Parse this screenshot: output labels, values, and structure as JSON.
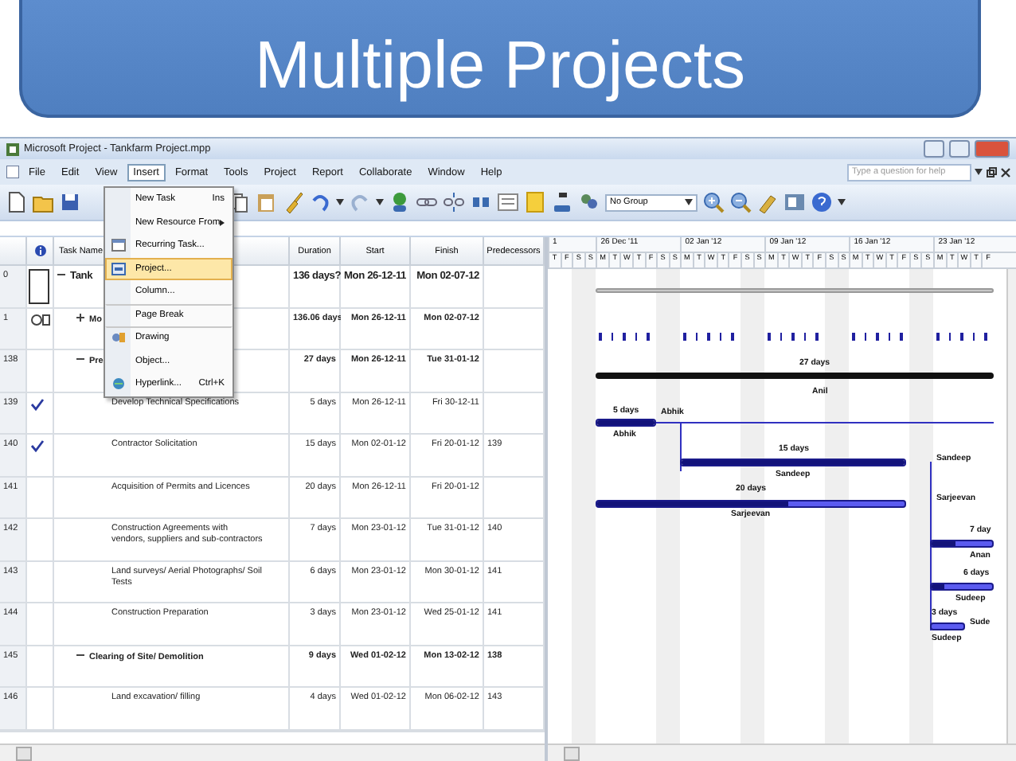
{
  "slide_title": "Multiple Projects",
  "window": {
    "title": "Microsoft Project - Tankfarm Project.mpp"
  },
  "menu_bar": [
    {
      "label": "File",
      "selected": false
    },
    {
      "label": "Edit",
      "selected": false
    },
    {
      "label": "View",
      "selected": false
    },
    {
      "label": "Insert",
      "selected": true
    },
    {
      "label": "Format",
      "selected": false
    },
    {
      "label": "Tools",
      "selected": false
    },
    {
      "label": "Project",
      "selected": false
    },
    {
      "label": "Report",
      "selected": false
    },
    {
      "label": "Collaborate",
      "selected": false
    },
    {
      "label": "Window",
      "selected": false
    },
    {
      "label": "Help",
      "selected": false
    }
  ],
  "help_field": {
    "placeholder": "Type a question for help"
  },
  "toolbar": {
    "group_select": "No Group"
  },
  "insert_menu": [
    {
      "label": "New Task",
      "shortcut": "Ins",
      "submenu": false,
      "selected": false,
      "separator_before": false
    },
    {
      "label": "New Resource From",
      "submenu": true,
      "selected": false,
      "separator_before": false
    },
    {
      "label": "Recurring Task...",
      "submenu": false,
      "selected": false,
      "separator_before": false
    },
    {
      "label": "Project...",
      "submenu": false,
      "selected": true,
      "separator_before": false
    },
    {
      "label": "Column...",
      "submenu": false,
      "selected": false,
      "separator_before": false
    },
    {
      "label": "Page Break",
      "submenu": false,
      "selected": false,
      "separator_before": true
    },
    {
      "label": "Drawing",
      "submenu": false,
      "selected": false,
      "separator_before": true
    },
    {
      "label": "Object...",
      "submenu": false,
      "selected": false,
      "separator_before": false
    },
    {
      "label": "Hyperlink...",
      "shortcut": "Ctrl+K",
      "submenu": false,
      "selected": false,
      "separator_before": false
    }
  ],
  "table": {
    "columns": [
      "Task Name",
      "Duration",
      "Start",
      "Finish",
      "Predecessors"
    ],
    "rows": [
      {
        "id": "0",
        "name": "Tank",
        "duration": "136 days?",
        "start": "Mon 26-12-11",
        "finish": "Mon 02-07-12",
        "summary": true,
        "expanded": true,
        "indicator_box": true,
        "children": [
          {
            "id": "1",
            "name": "Mo",
            "duration": "136.06 days",
            "start": "Mon 26-12-11",
            "finish": "Mon 02-07-12",
            "summary": true,
            "expanded": false,
            "recurring": true,
            "done": false
          },
          {
            "id": "138",
            "name": "Pre",
            "duration": "27 days",
            "start": "Mon 26-12-11",
            "finish": "Tue 31-01-12",
            "summary": true,
            "expanded": true,
            "done": false,
            "bar_top": "27 days",
            "bar_bottom": "Anil",
            "children": [
              {
                "id": "139",
                "name": "Develop Technical Specifications",
                "duration": "5 days",
                "start": "Mon 26-12-11",
                "finish": "Fri 30-12-11",
                "summary": false,
                "done": true,
                "level": 1,
                "bar_top": "5 days",
                "bar_right": "Abhik",
                "bar_bottom": "Abhik"
              },
              {
                "id": "140",
                "name": "Contractor Solicitation",
                "duration": "15 days",
                "start": "Mon 02-01-12",
                "finish": "Fri 20-01-12",
                "predecessors": "139",
                "summary": false,
                "done": true,
                "level": 1,
                "bar_top": "15 days",
                "bar_right": "Sandeep",
                "bar_bottom": "Sandeep"
              },
              {
                "id": "141",
                "name": "Acquisition of Permits and Licences",
                "duration": "20 days",
                "start": "Mon 26-12-11",
                "finish": "Fri 20-01-12",
                "summary": false,
                "done": false,
                "level": 0.62,
                "bar_top": "20 days",
                "bar_right": "Sarjeevan",
                "bar_bottom": "Sarjeevan"
              },
              {
                "id": "142",
                "name": "Construction Agreements with vendors, suppliers and sub-contractors",
                "duration": "7 days",
                "start": "Mon 23-01-12",
                "finish": "Tue 31-01-12",
                "predecessors": "140",
                "summary": false,
                "done": false,
                "level": 0.4,
                "bar_top": "7 day",
                "bar_bottom": "Anan"
              },
              {
                "id": "143",
                "name": "Land surveys/ Aerial Photographs/ Soil Tests",
                "duration": "6 days",
                "start": "Mon 23-01-12",
                "finish": "Mon 30-01-12",
                "predecessors": "141",
                "summary": false,
                "done": false,
                "level": 0.2,
                "bar_top": "6 days",
                "bar_bottom": "Sudeep"
              },
              {
                "id": "144",
                "name": "Construction Preparation",
                "duration": "3 days",
                "start": "Mon 23-01-12",
                "finish": "Wed 25-01-12",
                "predecessors": "141",
                "summary": false,
                "done": false,
                "bar_top": "3 days",
                "bar_right": "Sude",
                "bar_bottom": "Sudeep"
              }
            ]
          },
          {
            "id": "145",
            "name": "Clearing of Site/ Demolition",
            "duration": "9 days",
            "start": "Wed 01-02-12",
            "finish": "Mon 13-02-12",
            "predecessors": "138",
            "summary": true,
            "expanded": true,
            "done": false,
            "children": [
              {
                "id": "146",
                "name": "Land excavation/ filling",
                "duration": "4 days",
                "start": "Wed 01-02-12",
                "finish": "Mon 06-02-12",
                "predecessors": "143",
                "summary": false,
                "done": false
              }
            ]
          }
        ]
      }
    ]
  },
  "timescale": {
    "weeks": [
      "1",
      "26 Dec '11",
      "02 Jan '12",
      "09 Jan '12",
      "16 Jan '12",
      "23 Jan '12"
    ],
    "days": [
      "T",
      "F",
      "S",
      "S",
      "M",
      "T",
      "W",
      "T",
      "F",
      "S",
      "S",
      "M",
      "T",
      "W",
      "T",
      "F",
      "S",
      "S",
      "M",
      "T",
      "W",
      "T",
      "F",
      "S",
      "S",
      "M",
      "T",
      "W",
      "T",
      "F",
      "S",
      "S",
      "M",
      "T",
      "W",
      "T",
      "F"
    ]
  }
}
